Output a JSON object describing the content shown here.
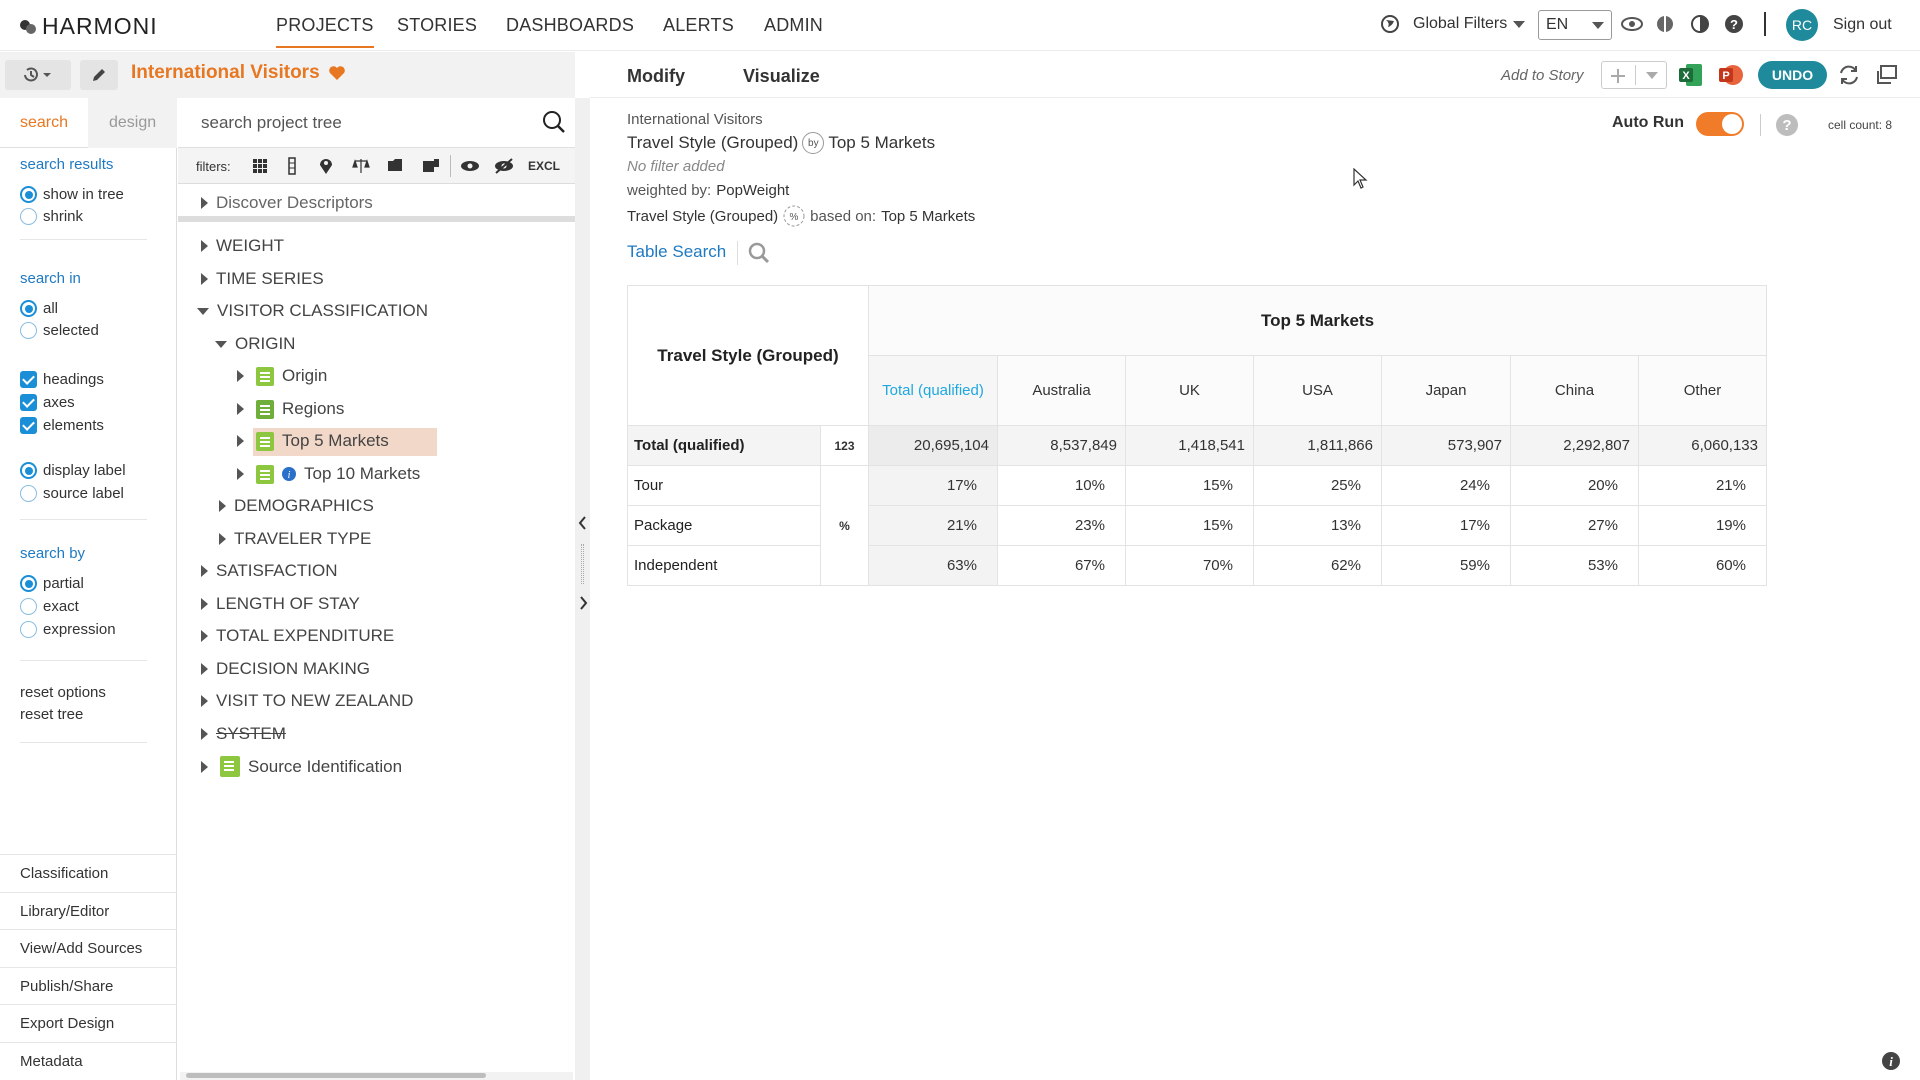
{
  "nav": {
    "logo": "HARMONI",
    "items": [
      "PROJECTS",
      "STORIES",
      "DASHBOARDS",
      "ALERTS",
      "ADMIN"
    ],
    "global_filters": "Global Filters",
    "lang": "EN",
    "avatar": "RC",
    "sign_out": "Sign out"
  },
  "project": {
    "title": "International Visitors"
  },
  "left": {
    "tab_search": "search",
    "tab_design": "design",
    "search_results": "search results",
    "show_in_tree": "show in tree",
    "shrink": "shrink",
    "search_in": "search in",
    "all": "all",
    "selected": "selected",
    "headings": "headings",
    "axes": "axes",
    "elements": "elements",
    "display_label": "display label",
    "source_label": "source label",
    "search_by": "search by",
    "partial": "partial",
    "exact": "exact",
    "expression": "expression",
    "reset_options": "reset options",
    "reset_tree": "reset tree",
    "bottom_links": [
      "Classification",
      "Library/Editor",
      "View/Add Sources",
      "Publish/Share",
      "Export Design",
      "Metadata"
    ]
  },
  "tree": {
    "search_placeholder": "search project tree",
    "filters_label": "filters:",
    "excl": "EXCL",
    "items": {
      "discover": "Discover Descriptors",
      "weight": "WEIGHT",
      "time_series": "TIME SERIES",
      "visitor_classification": "VISITOR CLASSIFICATION",
      "origin_folder": "ORIGIN",
      "origin": "Origin",
      "regions": "Regions",
      "top5": "Top 5 Markets",
      "top10": "Top 10 Markets",
      "demographics": "DEMOGRAPHICS",
      "traveler_type": "TRAVELER TYPE",
      "satisfaction": "SATISFACTION",
      "length_of_stay": "LENGTH OF STAY",
      "total_expenditure": "TOTAL EXPENDITURE",
      "decision_making": "DECISION MAKING",
      "visit_nz": "VISIT TO NEW ZEALAND",
      "system": "SYSTEM",
      "source_identification": "Source Identification"
    }
  },
  "toolbar": {
    "modify": "Modify",
    "visualize": "Visualize",
    "add_to_story": "Add to Story",
    "undo": "UNDO"
  },
  "report": {
    "source": "International Visitors",
    "row_var": "Travel Style (Grouped)",
    "by": "by",
    "col_var": "Top 5 Markets",
    "no_filter": "No filter added",
    "weighted_by_label": "weighted by:",
    "weighted_by": "PopWeight",
    "pct_var": "Travel Style (Grouped)",
    "based_on_label": "based on:",
    "based_on": "Top 5 Markets",
    "table_search": "Table Search",
    "auto_run": "Auto Run",
    "cell_count": "cell count: 8"
  },
  "table": {
    "corner": "Travel Style (Grouped)",
    "col_header": "Top 5 Markets",
    "columns": [
      "Total (qualified)",
      "Australia",
      "UK",
      "USA",
      "Japan",
      "China",
      "Other"
    ],
    "total_label": "Total (qualified)",
    "total_unit": "123",
    "total_values": [
      "20,695,104",
      "8,537,849",
      "1,418,541",
      "1,811,866",
      "573,907",
      "2,292,807",
      "6,060,133"
    ],
    "pct_unit": "%",
    "rows": [
      {
        "label": "Tour",
        "values": [
          "17%",
          "10%",
          "15%",
          "25%",
          "24%",
          "20%",
          "21%"
        ]
      },
      {
        "label": "Package",
        "values": [
          "21%",
          "23%",
          "15%",
          "13%",
          "17%",
          "27%",
          "19%"
        ]
      },
      {
        "label": "Independent",
        "values": [
          "63%",
          "67%",
          "70%",
          "62%",
          "59%",
          "53%",
          "60%"
        ]
      }
    ]
  },
  "colors": {
    "accent": "#e87722",
    "link": "#1f7ac2",
    "undo": "#1f8a9c",
    "toggle": "#f07c2a"
  }
}
